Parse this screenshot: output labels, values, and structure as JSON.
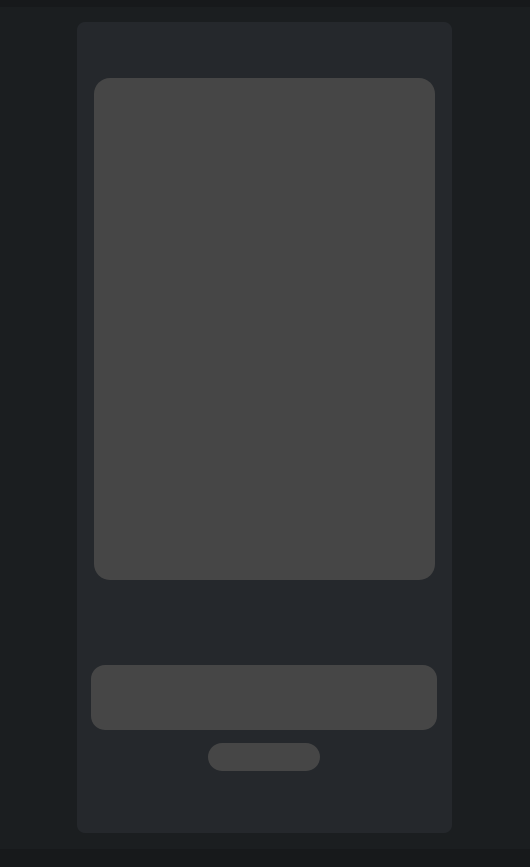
{
  "colors": {
    "page_background": "#1b1e20",
    "edge_strip": "#17191b",
    "card_background": "#25282c",
    "skeleton": "#464646"
  },
  "state": "loading-skeleton"
}
